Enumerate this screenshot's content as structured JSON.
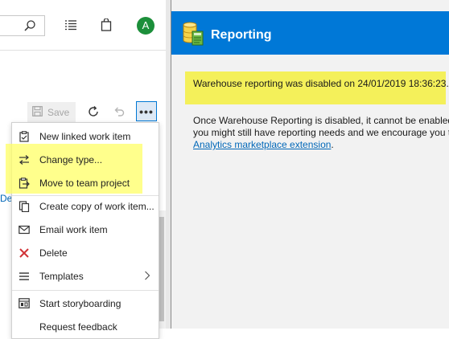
{
  "top_bar": {
    "avatar_initial": "A",
    "icons": [
      "search-icon",
      "list-icon",
      "bag-icon"
    ]
  },
  "toolbar": {
    "save_label": "Save",
    "more_label": "•••"
  },
  "partial_link": "De",
  "context_menu": {
    "items": [
      {
        "label": "New linked work item",
        "icon": "new-linked-icon"
      },
      {
        "label": "Change type...",
        "icon": "change-type-icon"
      },
      {
        "label": "Move to team project",
        "icon": "move-project-icon"
      },
      {
        "label": "Create copy of work item...",
        "icon": "copy-icon"
      },
      {
        "label": "Email work item",
        "icon": "email-icon"
      },
      {
        "label": "Delete",
        "icon": "delete-icon"
      },
      {
        "label": "Templates",
        "icon": "templates-icon"
      },
      {
        "label": "Start storyboarding",
        "icon": "storyboard-icon"
      },
      {
        "label": "Request feedback",
        "icon": "feedback-icon"
      }
    ]
  },
  "reporting": {
    "title": "Reporting",
    "disabled_message": "Warehouse reporting was disabled on 24/01/2019 18:36:23.",
    "body_line1": "Once Warehouse Reporting is disabled, it cannot be enabled",
    "body_line2": "you might still have reporting needs and we encourage you t",
    "body_link": "Analytics marketplace extension",
    "body_link_tail": "."
  },
  "colors": {
    "accent": "#0078d7",
    "highlight": "#ffff66",
    "delete_red": "#d13438",
    "avatar_green": "#1c8f3a"
  }
}
